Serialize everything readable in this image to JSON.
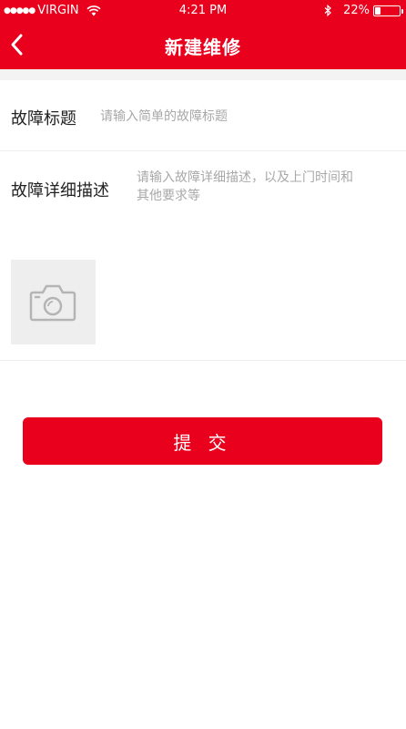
{
  "status_bar": {
    "carrier": "VIRGIN",
    "time": "4:21 PM",
    "battery": "22%"
  },
  "nav": {
    "title": "新建维修"
  },
  "form": {
    "title_label": "故障标题",
    "title_placeholder": "请输入简单的故障标题",
    "desc_label": "故障详细描述",
    "desc_placeholder": "请输入故障详细描述，以及上门时间和其他要求等"
  },
  "submit_label": "提 交",
  "colors": {
    "brand_red": "#e8001c",
    "placeholder": "#a8a8a8"
  }
}
